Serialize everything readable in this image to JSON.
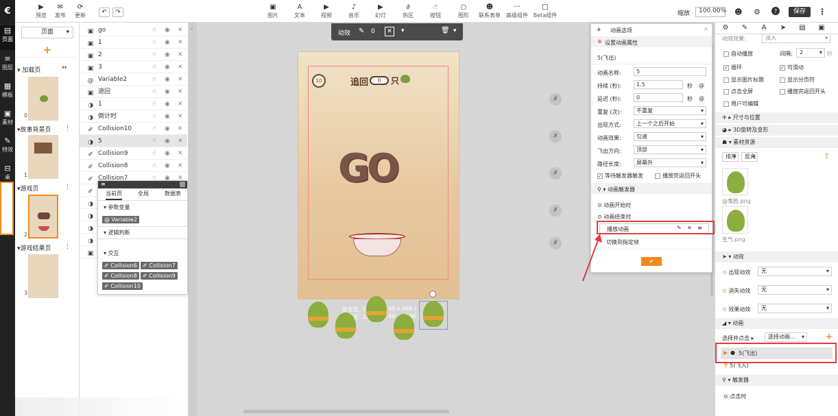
{
  "app": {
    "logo": "€"
  },
  "top": {
    "left": [
      {
        "icon": "▶",
        "label": "预览"
      },
      {
        "icon": "✉",
        "label": "发布"
      },
      {
        "icon": "⟳",
        "label": "更新"
      }
    ],
    "undo": "↶",
    "redo": "↷",
    "tools": [
      {
        "icon": "▣",
        "label": "图片"
      },
      {
        "icon": "A",
        "label": "文本"
      },
      {
        "icon": "▶",
        "label": "视频"
      },
      {
        "icon": "♪",
        "label": "音乐"
      },
      {
        "icon": "▶",
        "label": "幻灯"
      },
      {
        "icon": "∂",
        "label": "热区"
      },
      {
        "icon": "☝",
        "label": "按钮"
      },
      {
        "icon": "○",
        "label": "图形"
      },
      {
        "icon": "☻",
        "label": "联系表单"
      },
      {
        "icon": "···",
        "label": "高级组件"
      },
      {
        "icon": "□",
        "label": "Beta组件"
      }
    ],
    "zoom_label": "缩放",
    "zoom_value": "100.00%",
    "save": "保存"
  },
  "nav": [
    {
      "icon": "▤",
      "label": "页面"
    },
    {
      "icon": "≡",
      "label": "图层"
    },
    {
      "icon": "▦",
      "label": "模板"
    },
    {
      "icon": "▣",
      "label": "素材"
    },
    {
      "icon": "✎",
      "label": "特效"
    },
    {
      "icon": "⊟",
      "label": "桌"
    }
  ],
  "pages": {
    "select": "页面",
    "add": "+",
    "groups": [
      {
        "name": "加载页",
        "num": "0"
      },
      {
        "name": "故事背景页",
        "num": "1"
      },
      {
        "name": "游戏页",
        "num": "2"
      },
      {
        "name": "游戏结果页",
        "num": "3"
      }
    ]
  },
  "layers": [
    {
      "icon": "▣",
      "name": "go"
    },
    {
      "icon": "▣",
      "name": "1"
    },
    {
      "icon": "▣",
      "name": "2"
    },
    {
      "icon": "▣",
      "name": "3"
    },
    {
      "icon": "@",
      "name": "Variable2"
    },
    {
      "icon": "▣",
      "name": "退回"
    },
    {
      "icon": "◑",
      "name": "1"
    },
    {
      "icon": "◑",
      "name": "倒计时"
    },
    {
      "icon": "✐",
      "name": "Collision10"
    },
    {
      "icon": "◑",
      "name": "5"
    },
    {
      "icon": "✐",
      "name": "Collision9"
    },
    {
      "icon": "✐",
      "name": "Collision8"
    },
    {
      "icon": "✐",
      "name": "Collision7"
    },
    {
      "icon": "✐",
      "name": ""
    },
    {
      "icon": "◑",
      "name": ""
    },
    {
      "icon": "◑",
      "name": ""
    },
    {
      "icon": "◑",
      "name": ""
    },
    {
      "icon": "◑",
      "name": ""
    },
    {
      "icon": "▣",
      "name": ""
    }
  ],
  "varpopup": {
    "tabs": [
      "当前页",
      "全局",
      "数据表"
    ],
    "sec1": "参数变量",
    "var_chip": "Variable2",
    "sec2": "逻辑判断",
    "sec3": "交互",
    "chips": [
      "Collision6",
      "Collision7",
      "Collision8",
      "Collision9",
      "Collision10"
    ]
  },
  "toolbar": {
    "effect": "动效",
    "count": "0"
  },
  "stage": {
    "back_label": "追回",
    "counter": "0",
    "unit": "只",
    "go_text": "GO",
    "safe_line1": "安全区: 32",
    "safe_dims1": "40 x 960 )",
    "safe_line2": "出血区: 37",
    "safe_dims2": "40 x 1136 )"
  },
  "animdlg": {
    "title": "动画选项",
    "section1": "设置动画属性",
    "anim_item": "5(飞出)",
    "fields": [
      {
        "label": "动画名称:",
        "value": "5",
        "type": "input"
      },
      {
        "label": "持续 (秒):",
        "value": "1.5",
        "type": "input",
        "unit": "秒"
      },
      {
        "label": "延迟 (秒):",
        "value": "0",
        "type": "input",
        "unit": "秒"
      },
      {
        "label": "重复 (次):",
        "value": "不重复",
        "type": "select"
      },
      {
        "label": "出现方式:",
        "value": "上一个之后开始",
        "type": "select"
      },
      {
        "label": "动画效果:",
        "value": "匀速",
        "type": "select"
      },
      {
        "label": "飞出方向:",
        "value": "顶部",
        "type": "select"
      },
      {
        "label": "路径长度:",
        "value": "屏幕外",
        "type": "select"
      }
    ],
    "cb1": "等待触发器触发",
    "cb2": "播放完返回开头",
    "section2": "动画触发器",
    "trigger1": "动画开始时",
    "trigger2": "动画结束时",
    "play": "播放动画",
    "switch": "切换到指定帧",
    "ok": "✔"
  },
  "right": {
    "tabs": [
      "⚙",
      "✎",
      "A",
      "➤",
      "▤",
      "▣"
    ],
    "top_label": "动效效果:",
    "top_value": "淡入",
    "autoplay": "自动播放",
    "interval_label": "间隔:",
    "interval_value": "2",
    "interval_unit": "秒",
    "loop": "循环",
    "swipe": "可滑动",
    "show_title": "显示图片标题",
    "show_pages": "显示分页符",
    "fullscreen": "点击全屏",
    "play_return": "播放完返回开头",
    "user_edit": "用户可编辑",
    "sec_size": "尺寸与位置",
    "sec_3d": "3D旋转及变形",
    "sec_res": "素材资源",
    "sort": "排序",
    "reverse": "反向",
    "res": [
      {
        "name": "@鬼脸.png"
      },
      {
        "name": "生气.png"
      }
    ],
    "sec_effects": "动效",
    "appear_label": "出现动效",
    "appear_value": "无",
    "disappear_label": "消失动效",
    "disappear_value": "无",
    "effect_label": "效果动效",
    "effect_value": "无",
    "sec_anim": "动画",
    "choose_click": "选择并点击",
    "choose_anim": "选择动画...",
    "anim_items": [
      {
        "label": "5(飞出)"
      },
      {
        "label": "5(飞入)"
      }
    ],
    "sec_trigger": "触发器",
    "trigger_item": "点击时"
  },
  "colors": {
    "accent": "#f08a1e",
    "highlight": "#e83a3a",
    "dark": "#3a3a3a"
  }
}
